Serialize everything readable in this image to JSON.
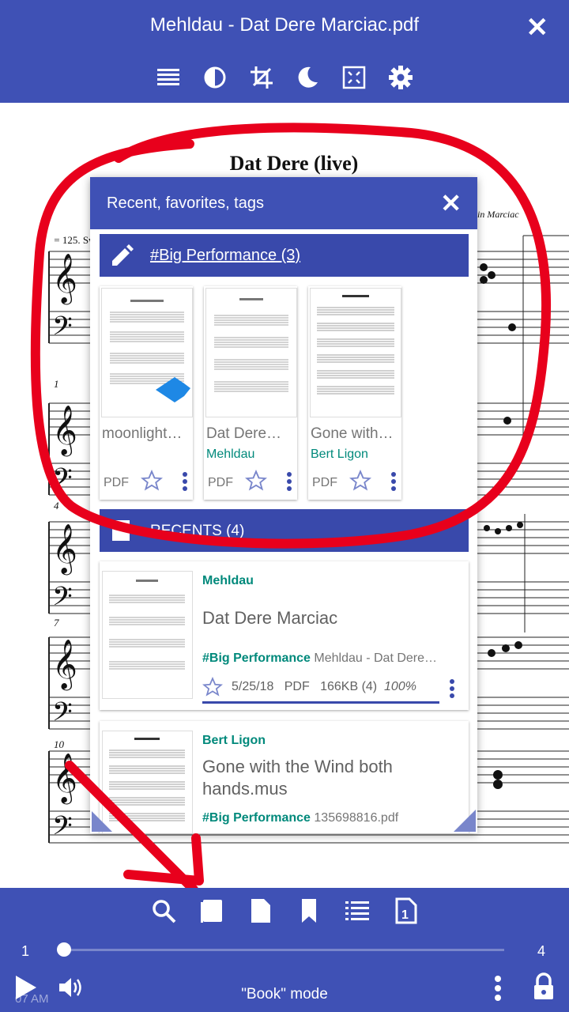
{
  "header": {
    "title": "Mehldau - Dat Dere Marciac.pdf",
    "close_label": "✕",
    "toolbar_icons": [
      "list-icon",
      "contrast-icon",
      "crop-icon",
      "moon-icon",
      "fit-screen-icon",
      "gear-icon"
    ]
  },
  "sheet": {
    "title": "Dat Dere (live)",
    "tempo": "♩ = 125. Sw",
    "right_text": "in Marciac",
    "measure_numbers": [
      "1",
      "4",
      "7",
      "10"
    ]
  },
  "popup": {
    "title": "Recent, favorites, tags",
    "close_label": "✕",
    "tag_label": "#Big Performance (3)",
    "cards": [
      {
        "title": "moonlight…",
        "author": "",
        "type": "PDF"
      },
      {
        "title": "Dat Dere…",
        "author": "Mehldau",
        "type": "PDF"
      },
      {
        "title": "Gone with…",
        "author": "Bert Ligon",
        "type": "PDF"
      }
    ],
    "recents_label": "RECENTS (4)",
    "recents": [
      {
        "author": "Mehldau",
        "title": "Dat Dere Marciac",
        "tag": "#Big Performance",
        "tag_rest": "Mehldau - Dat Dere…",
        "date": "5/25/18",
        "type": "PDF",
        "size": "166KB (4)",
        "percent": "100%"
      },
      {
        "author": "Bert Ligon",
        "title": "Gone with the Wind both hands.mus",
        "tag": "#Big Performance",
        "tag_rest": "135698816.pdf"
      }
    ]
  },
  "bottom": {
    "icons": [
      "search-icon",
      "book-icon",
      "page-icon",
      "bookmark-icon",
      "list-icon",
      "page-number-icon"
    ],
    "page_start": "1",
    "page_end": "4",
    "slider_value": 0,
    "mode_label": "\"Book\" mode",
    "time": "07 AM"
  },
  "colors": {
    "primary": "#3f51b5",
    "accent_teal": "#00897b",
    "annotation_red": "#e8001c"
  }
}
